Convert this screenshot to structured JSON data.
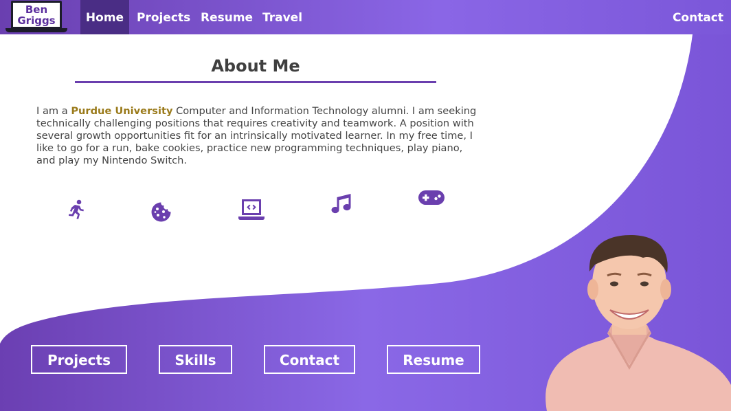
{
  "logo": {
    "line1": "Ben",
    "line2": "Griggs"
  },
  "nav": {
    "home": "Home",
    "projects": "Projects",
    "resume": "Resume",
    "travel": "Travel",
    "contact": "Contact"
  },
  "about": {
    "title": "About Me",
    "intro_before": "I am a ",
    "highlight": "Purdue University",
    "intro_after": " Computer and Information Technology alumni. I am seeking technically challenging positions that requires creativity and teamwork. A position with several growth opportunities fit for an intrinsically motivated learner. In my free time, I like to go for a run, bake cookies, practice new programming techniques, play piano, and play my Nintendo Switch."
  },
  "hobby_icons": [
    "running-icon",
    "cookie-icon",
    "laptop-code-icon",
    "music-icon",
    "gamepad-icon"
  ],
  "buttons": {
    "projects": "Projects",
    "skills": "Skills",
    "contact": "Contact",
    "resume": "Resume"
  },
  "colors": {
    "accent": "#6a3fae",
    "highlight": "#9a7a1a",
    "gradient_start": "#6b3fb2",
    "gradient_mid": "#8a68e6"
  }
}
